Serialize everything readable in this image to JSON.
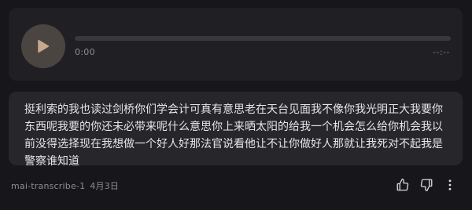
{
  "player": {
    "current_time": "0:00",
    "total_time": "--:--",
    "progress": 0
  },
  "transcript": {
    "text": "挺利索的我也读过剑桥你们学会计可真有意思老在天台见面我不像你我光明正大我要你东西呢我要的你还未必带来呢什么意思你上来晒太阳的给我一个机会怎么给你机会我以前没得选择现在我想做一个好人好那法官说看他让不让你做好人那就让我死对不起我是警察谁知道"
  },
  "footer": {
    "source": "mai-transcribe-1",
    "date": "4月3日"
  },
  "icons": {
    "play": "play-icon",
    "like": "thumbs-up-icon",
    "dislike": "thumbs-down-icon",
    "more": "more-vertical-icon"
  },
  "colors": {
    "background": "#17171b",
    "player_card": "#202024",
    "transcript_card": "#26262b",
    "play_button": "#4b4541",
    "play_icon": "#c7a98e",
    "text": "#e6e6e9"
  }
}
